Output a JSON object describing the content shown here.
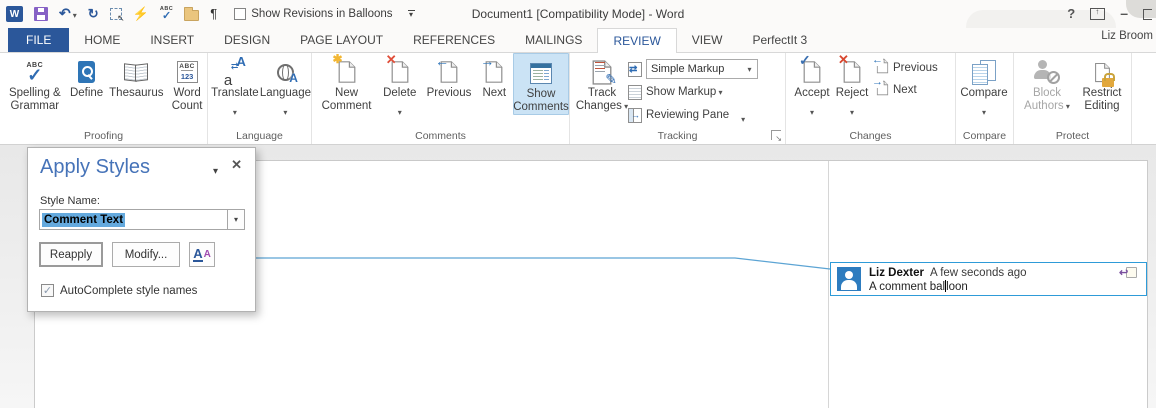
{
  "titlebar": {
    "title": "Document1 [Compatibility Mode] - Word",
    "balloons_checkbox_label": "Show Revisions in Balloons",
    "user_name": "Liz Broom"
  },
  "tabs": [
    {
      "label": "FILE"
    },
    {
      "label": "HOME"
    },
    {
      "label": "INSERT"
    },
    {
      "label": "DESIGN"
    },
    {
      "label": "PAGE LAYOUT"
    },
    {
      "label": "REFERENCES"
    },
    {
      "label": "MAILINGS"
    },
    {
      "label": "REVIEW"
    },
    {
      "label": "VIEW"
    },
    {
      "label": "PerfectIt 3"
    }
  ],
  "ribbon": {
    "proofing": {
      "group_label": "Proofing",
      "spelling_line1": "Spelling &",
      "spelling_line2": "Grammar",
      "spelling_icon_text": "ABC",
      "define": "Define",
      "thesaurus": "Thesaurus",
      "word_count_line1": "Word",
      "word_count_line2": "Count",
      "word_count_icon_top": "ABC",
      "word_count_icon_bottom": "123"
    },
    "language": {
      "group_label": "Language",
      "translate": "Translate",
      "language": "Language"
    },
    "comments": {
      "group_label": "Comments",
      "new_line1": "New",
      "new_line2": "Comment",
      "delete": "Delete",
      "previous": "Previous",
      "next": "Next",
      "show_line1": "Show",
      "show_line2": "Comments"
    },
    "tracking": {
      "group_label": "Tracking",
      "track_line1": "Track",
      "track_line2": "Changes",
      "markup_value": "Simple Markup",
      "show_markup": "Show Markup",
      "reviewing_pane": "Reviewing Pane"
    },
    "changes": {
      "group_label": "Changes",
      "accept": "Accept",
      "reject": "Reject",
      "previous": "Previous",
      "next": "Next"
    },
    "compare": {
      "group_label": "Compare",
      "compare": "Compare"
    },
    "protect": {
      "group_label": "Protect",
      "block_line1": "Block",
      "block_line2": "Authors",
      "restrict_line1": "Restrict",
      "restrict_line2": "Editing"
    }
  },
  "dialog": {
    "title": "Apply Styles",
    "style_name_label": "Style Name:",
    "style_name_value": "Comment Text",
    "reapply": "Reapply",
    "modify": "Modify...",
    "autocomplete_label": "AutoComplete style names"
  },
  "comment": {
    "author": "Liz Dexter",
    "timestamp": "A few seconds ago",
    "text_before_caret": "A comment bal",
    "text_after_caret": "loon"
  },
  "colors": {
    "accent": "#2b579a",
    "balloon_border": "#2e9bd8",
    "selection": "#64a9dd",
    "show_comments_bg": "#cbe3f5"
  }
}
